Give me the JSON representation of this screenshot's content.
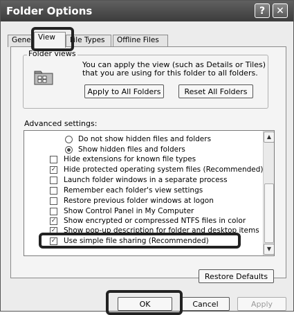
{
  "window": {
    "title": "Folder Options",
    "help_label": "?",
    "close_label": "✕"
  },
  "tabs": [
    "General",
    "View",
    "File Types",
    "Offline Files"
  ],
  "folder_views": {
    "label": "Folder views",
    "description": "You can apply the view (such as Details or Tiles) that you are using for this folder to all folders.",
    "apply_button": "Apply to All Folders",
    "reset_button": "Reset All Folders",
    "icon": "folder-icon"
  },
  "advanced": {
    "label": "Advanced settings:",
    "items": [
      {
        "type": "radio",
        "checked": false,
        "label": "Do not show hidden files and folders"
      },
      {
        "type": "radio",
        "checked": true,
        "label": "Show hidden files and folders"
      },
      {
        "type": "checkbox",
        "checked": false,
        "label": "Hide extensions for known file types"
      },
      {
        "type": "checkbox",
        "checked": true,
        "label": "Hide protected operating system files (Recommended)"
      },
      {
        "type": "checkbox",
        "checked": false,
        "label": "Launch folder windows in a separate process"
      },
      {
        "type": "checkbox",
        "checked": false,
        "label": "Remember each folder's view settings"
      },
      {
        "type": "checkbox",
        "checked": false,
        "label": "Restore previous folder windows at logon"
      },
      {
        "type": "checkbox",
        "checked": false,
        "label": "Show Control Panel in My Computer"
      },
      {
        "type": "checkbox",
        "checked": true,
        "label": "Show encrypted or compressed NTFS files in color"
      },
      {
        "type": "checkbox",
        "checked": true,
        "label": "Show pop-up description for folder and desktop items"
      },
      {
        "type": "checkbox",
        "checked": true,
        "label": "Use simple file sharing (Recommended)"
      }
    ]
  },
  "restore_defaults": "Restore Defaults",
  "footer": {
    "ok": "OK",
    "cancel": "Cancel",
    "apply": "Apply"
  }
}
